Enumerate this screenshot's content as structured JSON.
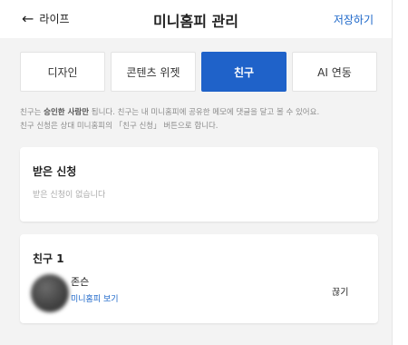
{
  "header": {
    "back_label": "라이프",
    "title": "미니홈피 관리",
    "save_label": "저장하기"
  },
  "tabs": [
    {
      "label": "디자인",
      "active": false
    },
    {
      "label": "콘텐츠 위젯",
      "active": false
    },
    {
      "label": "친구",
      "active": true
    },
    {
      "label": "AI 연동",
      "active": false
    }
  ],
  "info": {
    "line1_prefix": "친구는 ",
    "line1_bold": "승인한 사람만",
    "line1_suffix": " 됩니다. 친구는 내 미니홈피에 공유한 메모에 댓글을 달고 볼 수 있어요.",
    "line2": "친구 신청은 상대 미니홈피의 「친구 신청」 버튼으로 합니다."
  },
  "requests": {
    "title": "받은 신청",
    "empty_text": "받은 신청이 없습니다"
  },
  "friends": {
    "title": "친구 1",
    "items": [
      {
        "name": "존슨",
        "link": "미니홈피 보기",
        "action": "끊기"
      }
    ]
  },
  "colors": {
    "accent": "#1f62c9",
    "link": "#1b66c9",
    "background": "#f3f3f3"
  }
}
